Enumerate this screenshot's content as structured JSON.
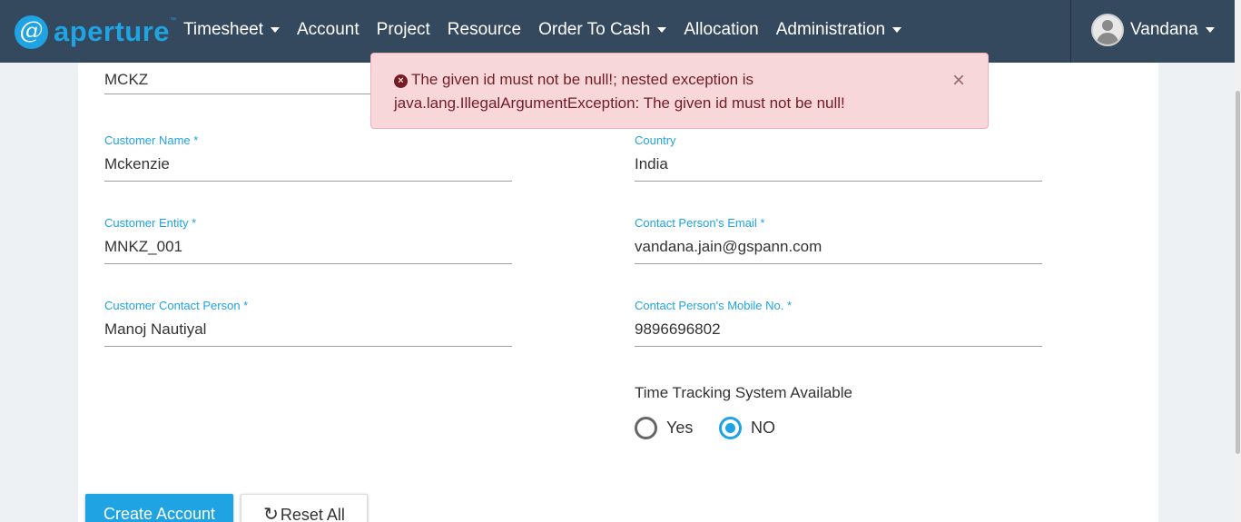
{
  "brand": {
    "logo_glyph": "@",
    "name": "aperture",
    "tm": "™"
  },
  "nav": {
    "timesheet": "Timesheet",
    "account": "Account",
    "project": "Project",
    "resource": "Resource",
    "order_to_cash": "Order To Cash",
    "allocation": "Allocation",
    "administration": "Administration"
  },
  "user": {
    "name": "Vandana"
  },
  "alert": {
    "message": "The given id must not be null!; nested exception is java.lang.IllegalArgumentException: The given id must not be null!",
    "close": "×",
    "icon_glyph": "×"
  },
  "form": {
    "customer_code_value": "MCKZ",
    "customer_name": {
      "label": "Customer Name *",
      "value": "Mckenzie"
    },
    "country": {
      "label": "Country",
      "value": "India"
    },
    "customer_entity": {
      "label": "Customer Entity *",
      "value": "MNKZ_001"
    },
    "contact_email": {
      "label": "Contact Person's Email *",
      "value": "vandana.jain@gspann.com"
    },
    "contact_person": {
      "label": "Customer Contact Person *",
      "value": "Manoj Nautiyal"
    },
    "contact_mobile": {
      "label": "Contact Person's Mobile No. *",
      "value": "9896696802"
    },
    "time_tracking": {
      "label": "Time Tracking System Available",
      "yes": "Yes",
      "no": "NO",
      "selected": "NO"
    }
  },
  "buttons": {
    "create": "Create Account",
    "reset_icon": "↻",
    "reset": "Reset All"
  },
  "colors": {
    "navbar": "#34495e",
    "accent": "#1fa3e3",
    "alert_bg": "#f8d7da",
    "alert_text": "#721c24"
  }
}
